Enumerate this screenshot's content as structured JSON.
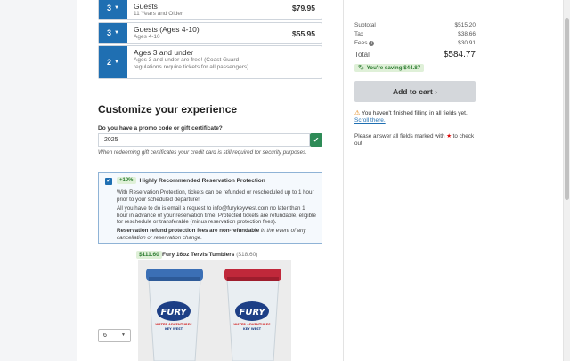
{
  "guests": [
    {
      "qty": "3",
      "name": "Guests",
      "sub": "11 Years and Older",
      "price": "$79.95"
    },
    {
      "qty": "3",
      "name": "Guests (Ages 4-10)",
      "sub": "Ages 4-10",
      "price": "$55.95"
    },
    {
      "qty": "2",
      "name": "Ages 3 and under",
      "sub": "Ages 3 and under are free! (Coast Guard regulations require tickets for all passengers)",
      "price": ""
    }
  ],
  "customize": {
    "heading": "Customize your experience",
    "promo_label": "Do you have a promo code or gift certificate?",
    "promo_value": "2025",
    "promo_note": "When redeeming gift certificates your credit card is still required for security purposes."
  },
  "protection": {
    "badge": "+10%",
    "title": "Highly Recommended Reservation Protection",
    "p1": "With Reservation Protection, tickets can be refunded or rescheduled up to 1 hour prior to your scheduled departure!",
    "p2": "All you have to do is email a request to info@furykeywest.com no later than 1 hour in advance of your reservation time. Protected tickets are refundable, eligible for reschedule or transferable (minus reservation protection fees).",
    "p3_bold": "Reservation refund protection fees are non-refundable",
    "p3_rest": " in the event of any cancellation or reservation change."
  },
  "tumbler": {
    "total": "$111.60",
    "name": "Fury 16oz Tervis Tumblers",
    "each": "($18.60)",
    "qty": "6",
    "cup_logo": "FURY",
    "cup_line1": "WATER ADVENTURES",
    "cup_line2": "KEY WEST"
  },
  "summary": {
    "subtotal_label": "Subtotal",
    "subtotal": "$515.20",
    "tax_label": "Tax",
    "tax": "$38.66",
    "fees_label": "Fees",
    "fees": "$30.91",
    "total_label": "Total",
    "total": "$584.77",
    "saving": "You're saving $44.87",
    "add_to_cart": "Add to cart ›",
    "warning": "You haven't finished filling in all fields yet.",
    "scroll_link": "Scroll there.",
    "hint_a": "Please answer all fields marked with ",
    "hint_star": "★",
    "hint_b": " to check out"
  },
  "colors": {
    "accent": "#1f6fb2",
    "success": "#2e8b57",
    "saving_bg": "#dff0d8",
    "warning": "#e07b00"
  },
  "icons": {
    "check": "✔",
    "caret": "▼",
    "tag": "🏷",
    "warn": "⚠",
    "info": "i"
  }
}
